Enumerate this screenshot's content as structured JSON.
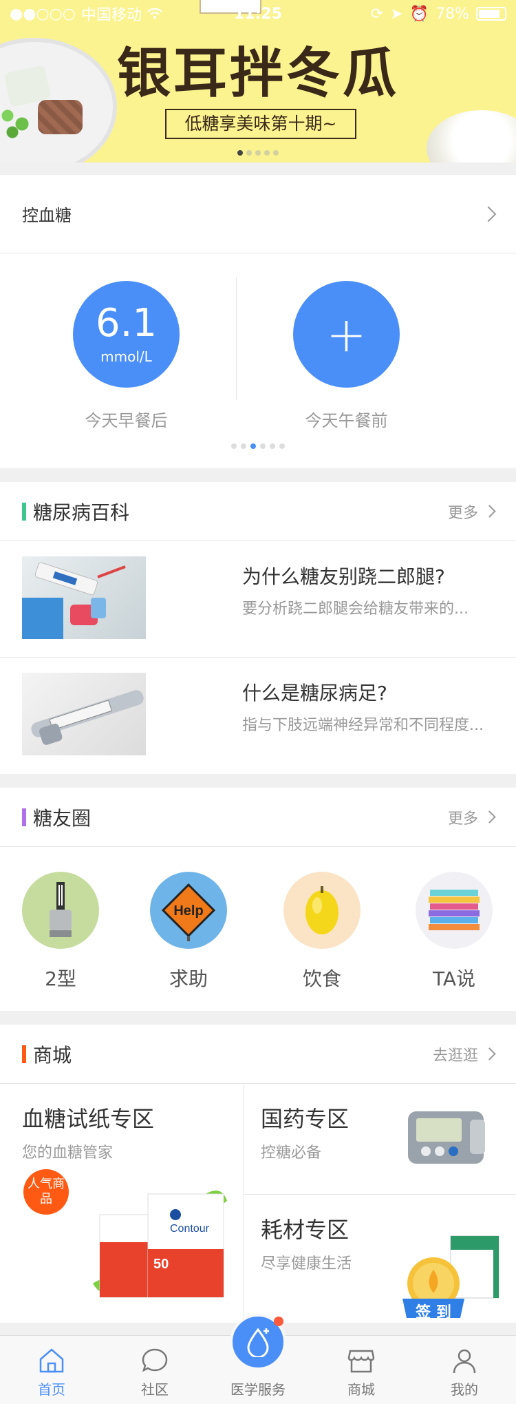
{
  "status_bar": {
    "carrier": "中国移动",
    "time": "11:25",
    "battery": "78%"
  },
  "banner": {
    "title": "银耳拌冬瓜",
    "subtitle": "低糖享美味第十期~"
  },
  "glucose_card": {
    "label": "控血糖",
    "reading": {
      "value": "6.1",
      "unit": "mmol/L",
      "caption": "今天早餐后"
    },
    "add": {
      "symbol": "+",
      "caption": "今天午餐前"
    }
  },
  "wiki": {
    "title": "糖尿病百科",
    "more": "更多",
    "accent": "#3cc88c",
    "articles": [
      {
        "title": "为什么糖友别跷二郎腿?",
        "desc": "要分析跷二郎腿会给糖友带来的..."
      },
      {
        "title": "什么是糖尿病足?",
        "desc": "指与下肢远端神经异常和不同程度..."
      }
    ]
  },
  "community": {
    "title": "糖友圈",
    "more": "更多",
    "accent": "#b070e8",
    "items": [
      {
        "label": "2型",
        "icon": "lancet-icon"
      },
      {
        "label": "求助",
        "icon": "help-sign-icon"
      },
      {
        "label": "饮食",
        "icon": "lemon-icon"
      },
      {
        "label": "TA说",
        "icon": "books-icon"
      }
    ]
  },
  "shop": {
    "title": "商城",
    "more": "去逛逛",
    "accent": "#ff5a14",
    "strips": {
      "title": "血糖试纸专区",
      "sub": "您的血糖管家",
      "badge": "人气商品"
    },
    "medicine": {
      "title": "国药专区",
      "sub": "控糖必备"
    },
    "supplies": {
      "title": "耗材专区",
      "sub": "尽享健康生活"
    },
    "checkin": "签 到"
  },
  "tabbar": {
    "home": "首页",
    "community": "社区",
    "medical": "医学服务",
    "mall": "商城",
    "mine": "我的",
    "active": "home",
    "accent": "#4a8ff8"
  }
}
